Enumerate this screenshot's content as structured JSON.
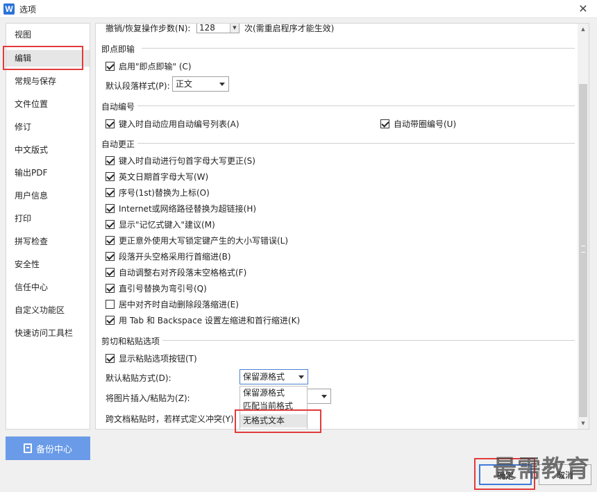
{
  "window": {
    "title": "选项",
    "app_icon_letter": "W"
  },
  "sidebar": {
    "items": [
      {
        "label": "视图"
      },
      {
        "label": "编辑"
      },
      {
        "label": "常规与保存"
      },
      {
        "label": "文件位置"
      },
      {
        "label": "修订"
      },
      {
        "label": "中文版式"
      },
      {
        "label": "输出PDF"
      },
      {
        "label": "用户信息"
      },
      {
        "label": "打印"
      },
      {
        "label": "拼写检查"
      },
      {
        "label": "安全性"
      },
      {
        "label": "信任中心"
      },
      {
        "label": "自定义功能区"
      },
      {
        "label": "快速访问工具栏"
      }
    ],
    "active": "编辑",
    "backup_label": "备份中心"
  },
  "content": {
    "undo": {
      "label": "撤销/恢复操作步数(N):",
      "value": "128",
      "suffix": "次(需重启程序才能生效)"
    },
    "instant_input": {
      "title": "即点即输",
      "enable": "启用\"即点即输\" (C)",
      "default_para_label": "默认段落样式(P):",
      "default_para_value": "正文"
    },
    "auto_number": {
      "title": "自动编号",
      "opt1": "键入时自动应用自动编号列表(A)",
      "opt2": "自动带圈编号(U)"
    },
    "auto_correct": {
      "title": "自动更正",
      "items": [
        {
          "label": "键入时自动进行句首字母大写更正(S)",
          "checked": true
        },
        {
          "label": "英文日期首字母大写(W)",
          "checked": true
        },
        {
          "label": "序号(1st)替换为上标(O)",
          "checked": true
        },
        {
          "label": "Internet或网络路径替换为超链接(H)",
          "checked": true
        },
        {
          "label": "显示\"记忆式键入\"建议(M)",
          "checked": true
        },
        {
          "label": "更正意外使用大写锁定键产生的大小写错误(L)",
          "checked": true
        },
        {
          "label": "段落开头空格采用行首缩进(B)",
          "checked": true
        },
        {
          "label": "自动调整右对齐段落末空格格式(F)",
          "checked": true
        },
        {
          "label": "直引号替换为弯引号(Q)",
          "checked": true
        },
        {
          "label": "居中对齐时自动删除段落缩进(E)",
          "checked": false
        },
        {
          "label": "用 Tab 和 Backspace 设置左缩进和首行缩进(K)",
          "checked": true
        }
      ]
    },
    "paste": {
      "title": "剪切和粘贴选项",
      "show_btn": "显示粘贴选项按钮(T)",
      "default_label": "默认粘贴方式(D):",
      "default_value": "保留源格式",
      "image_label": "将图片插入/粘贴为(Z):",
      "cross_doc_label": "跨文档粘贴时，若样式定义冲突(Y):",
      "dropdown_options": [
        "保留源格式",
        "匹配当前格式",
        "无格式文本"
      ]
    }
  },
  "buttons": {
    "ok": "确定",
    "cancel": "取消"
  },
  "watermark": "最需教育",
  "colors": {
    "accent": "#3f7ad8",
    "backup": "#6a9be8",
    "highlight": "#e23a3a"
  }
}
